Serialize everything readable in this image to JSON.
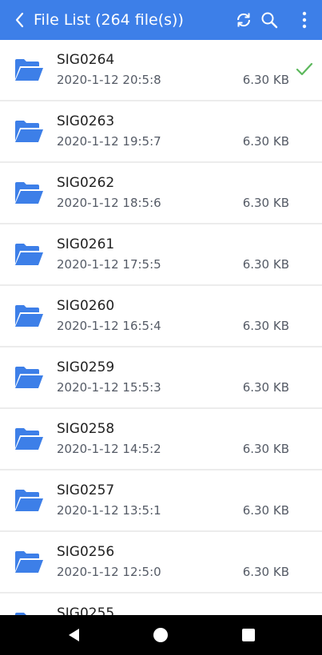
{
  "header": {
    "title": "File List (264 file(s))",
    "back_icon": "chevron-left-icon",
    "sync_icon": "sync-icon",
    "search_icon": "search-icon",
    "more_icon": "more-vert-icon",
    "bg_color": "#3d7fe8"
  },
  "files": [
    {
      "name": "SIG0264",
      "date": "2020-1-12 20:5:8",
      "size": "6.30 KB",
      "selected": true
    },
    {
      "name": "SIG0263",
      "date": "2020-1-12 19:5:7",
      "size": "6.30 KB",
      "selected": false
    },
    {
      "name": "SIG0262",
      "date": "2020-1-12 18:5:6",
      "size": "6.30 KB",
      "selected": false
    },
    {
      "name": "SIG0261",
      "date": "2020-1-12 17:5:5",
      "size": "6.30 KB",
      "selected": false
    },
    {
      "name": "SIG0260",
      "date": "2020-1-12 16:5:4",
      "size": "6.30 KB",
      "selected": false
    },
    {
      "name": "SIG0259",
      "date": "2020-1-12 15:5:3",
      "size": "6.30 KB",
      "selected": false
    },
    {
      "name": "SIG0258",
      "date": "2020-1-12 14:5:2",
      "size": "6.30 KB",
      "selected": false
    },
    {
      "name": "SIG0257",
      "date": "2020-1-12 13:5:1",
      "size": "6.30 KB",
      "selected": false
    },
    {
      "name": "SIG0256",
      "date": "2020-1-12 12:5:0",
      "size": "6.30 KB",
      "selected": false
    },
    {
      "name": "SIG0255",
      "date": "",
      "size": "",
      "selected": false
    }
  ],
  "icons": {
    "folder": "folder-icon",
    "check": "check-icon",
    "folder_color": "#3d7fe8",
    "check_color": "#5cb85c"
  },
  "navbar": {
    "back_icon": "nav-back-icon",
    "home_icon": "nav-home-icon",
    "recent_icon": "nav-recent-icon"
  }
}
